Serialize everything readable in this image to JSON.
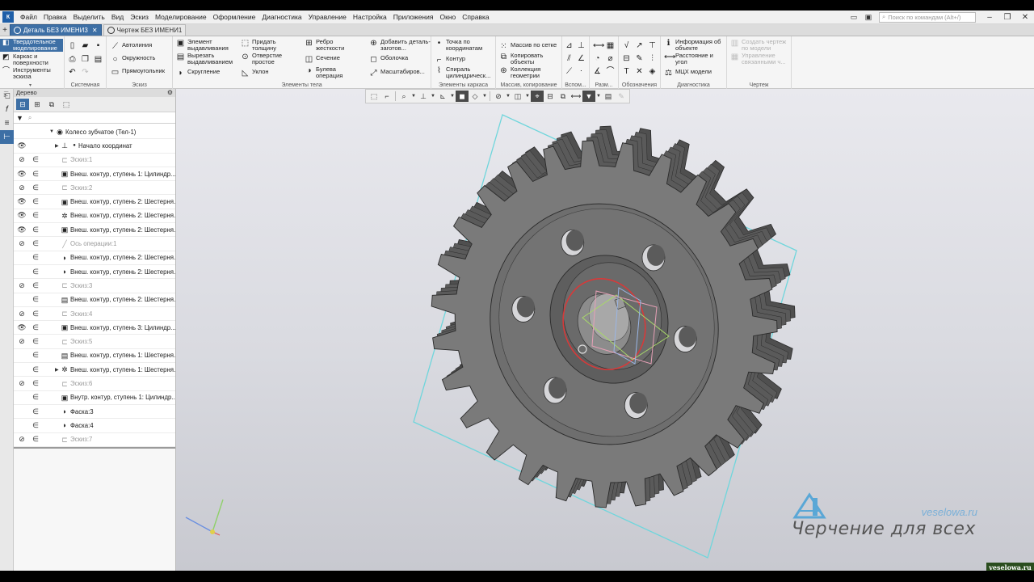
{
  "menu": {
    "logo_text": "К",
    "items": [
      "Файл",
      "Правка",
      "Выделить",
      "Вид",
      "Эскиз",
      "Моделирование",
      "Оформление",
      "Диагностика",
      "Управление",
      "Настройка",
      "Приложения",
      "Окно",
      "Справка"
    ],
    "search_placeholder": "Поиск по командам (Alt+/)"
  },
  "tabs": [
    {
      "label": "Деталь БЕЗ ИМЕНИ3",
      "active": true
    },
    {
      "label": "Чертеж БЕЗ ИМЕНИ1",
      "active": false
    }
  ],
  "ribbon": {
    "modes": [
      "Твердотельное моделирование",
      "Каркас и поверхности",
      "Инструменты эскиза"
    ],
    "groups": {
      "system": "Системная",
      "sketch": "Эскиз",
      "body": "Элементы тела",
      "frame": "Элементы каркаса",
      "array": "Массив, копирование",
      "aux": "Вспом...",
      "size": "Разм...",
      "notation": "Обозначения",
      "diag": "Диагностика",
      "drawing": "Чертеж"
    },
    "sketch_buttons": [
      "Автолиния",
      "Окружность",
      "Прямоугольник"
    ],
    "body_col1": [
      "Элемент выдавливания",
      "Вырезать выдавливанием",
      "Скругление"
    ],
    "body_col2": [
      "Придать толщину",
      "Отверстие простое",
      "Уклон"
    ],
    "body_col3": [
      "Ребро жесткости",
      "Сечение",
      "Булева операция"
    ],
    "body_col4": [
      "Добавить деталь-заготов...",
      "Оболочка",
      "Масштабиров..."
    ],
    "frame_buttons": [
      "Точка по координатам",
      "Контур",
      "Спираль цилиндрическ..."
    ],
    "array_buttons": [
      "Массив по сетке",
      "Копировать объекты",
      "Коллекция геометрии"
    ],
    "diag_buttons": [
      "Информация об объекте",
      "Расстояние и угол",
      "МЦХ модели"
    ],
    "drawing_buttons": [
      "Создать чертеж по модели",
      "Управление связанными ч..."
    ]
  },
  "tree": {
    "title": "Дерево",
    "filter_placeholder": "",
    "rows": [
      {
        "label": "Колесо зубчатое (Тел-1)",
        "eye": "",
        "link": false,
        "level": 0,
        "dim": false,
        "icon": "part-icon",
        "glyph": "◉"
      },
      {
        "label": "Начало координат",
        "eye": "👁",
        "link": false,
        "level": 1,
        "dim": false,
        "icon": "origin-icon",
        "glyph": "⊥"
      },
      {
        "label": "Эскиз:1",
        "eye": "⊘",
        "link": true,
        "level": 2,
        "dim": true,
        "icon": "sketch-icon",
        "glyph": "⊏"
      },
      {
        "label": "Внеш. контур, ступень 1: Цилиндр...",
        "eye": "👁",
        "link": true,
        "level": 2,
        "dim": false,
        "icon": "extrude-icon",
        "glyph": "▣"
      },
      {
        "label": "Эскиз:2",
        "eye": "⊘",
        "link": true,
        "level": 2,
        "dim": true,
        "icon": "sketch-icon",
        "glyph": "⊏"
      },
      {
        "label": "Внеш. контур, ступень 2: Шестерня...",
        "eye": "👁",
        "link": true,
        "level": 2,
        "dim": false,
        "icon": "extrude-icon",
        "glyph": "▣"
      },
      {
        "label": "Внеш. контур, ступень 2: Шестерня...",
        "eye": "👁",
        "link": true,
        "level": 2,
        "dim": false,
        "icon": "gear-feature-icon",
        "glyph": "✲"
      },
      {
        "label": "Внеш. контур, ступень 2: Шестерня...",
        "eye": "👁",
        "link": true,
        "level": 2,
        "dim": false,
        "icon": "extrude-icon",
        "glyph": "▣"
      },
      {
        "label": "Ось операции:1",
        "eye": "⊘",
        "link": true,
        "level": 2,
        "dim": true,
        "icon": "axis-icon",
        "glyph": "╱"
      },
      {
        "label": "Внеш. контур, ступень 2: Шестерня...",
        "eye": "",
        "link": true,
        "level": 2,
        "dim": false,
        "icon": "rotate-icon",
        "glyph": "◗"
      },
      {
        "label": "Внеш. контур, ступень 2: Шестерня...",
        "eye": "",
        "link": true,
        "level": 2,
        "dim": false,
        "icon": "rotate-icon",
        "glyph": "◗"
      },
      {
        "label": "Эскиз:3",
        "eye": "⊘",
        "link": true,
        "level": 2,
        "dim": true,
        "icon": "sketch-icon",
        "glyph": "⊏"
      },
      {
        "label": "Внеш. контур, ступень 2: Шестерня...",
        "eye": "",
        "link": true,
        "level": 2,
        "dim": false,
        "icon": "cut-icon",
        "glyph": "▤"
      },
      {
        "label": "Эскиз:4",
        "eye": "⊘",
        "link": true,
        "level": 2,
        "dim": true,
        "icon": "sketch-icon",
        "glyph": "⊏"
      },
      {
        "label": "Внеш. контур, ступень 3: Цилиндр...",
        "eye": "👁",
        "link": true,
        "level": 2,
        "dim": false,
        "icon": "extrude-icon",
        "glyph": "▣"
      },
      {
        "label": "Эскиз:5",
        "eye": "⊘",
        "link": true,
        "level": 2,
        "dim": true,
        "icon": "sketch-icon",
        "glyph": "⊏"
      },
      {
        "label": "Внеш. контур, ступень 1: Шестерня...",
        "eye": "",
        "link": true,
        "level": 2,
        "dim": false,
        "icon": "cut-icon",
        "glyph": "▤"
      },
      {
        "label": "Внеш. контур, ступень 1: Шестерня...",
        "eye": "",
        "link": true,
        "level": 2,
        "dim": false,
        "icon": "gear-feature-icon",
        "glyph": "✲"
      },
      {
        "label": "Эскиз:6",
        "eye": "⊘",
        "link": true,
        "level": 2,
        "dim": true,
        "icon": "sketch-icon",
        "glyph": "⊏"
      },
      {
        "label": "Внутр. контур, ступень 1: Цилиндр...",
        "eye": "",
        "link": true,
        "level": 2,
        "dim": false,
        "icon": "inner-cut-icon",
        "glyph": "▣"
      },
      {
        "label": "Фаска:3",
        "eye": "",
        "link": true,
        "level": 2,
        "dim": false,
        "icon": "chamfer-icon",
        "glyph": "◗"
      },
      {
        "label": "Фаска:4",
        "eye": "",
        "link": true,
        "level": 2,
        "dim": false,
        "icon": "chamfer-icon",
        "glyph": "◗"
      },
      {
        "label": "Эскиз:7",
        "eye": "⊘",
        "link": true,
        "level": 2,
        "dim": true,
        "icon": "sketch-icon",
        "glyph": "⊏"
      }
    ]
  },
  "gear": {
    "teeth": 27,
    "body_color": "#6b6b6b",
    "face_color": "#7a7a7a",
    "edge_color": "#2a2a2a",
    "plane_color": "#6fd6dc",
    "highlight_color": "#d63a3a"
  },
  "watermark": {
    "site_url": "veselowa.ru",
    "title": "Черчение для всех",
    "corner_url": "veselowa.ru"
  }
}
